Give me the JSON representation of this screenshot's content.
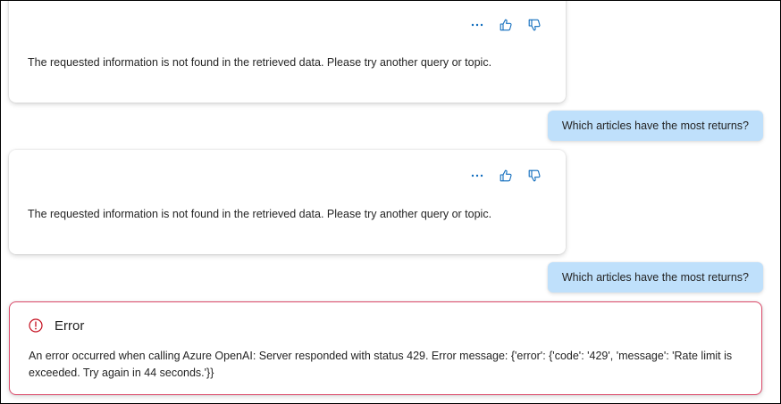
{
  "messages": [
    {
      "role": "assistant",
      "text": "The requested information is not found in the retrieved data. Please try another query or topic.",
      "actions": [
        "more-icon",
        "thumbs-up-icon",
        "thumbs-down-icon"
      ]
    },
    {
      "role": "user",
      "text": "Which articles have the most returns?"
    },
    {
      "role": "assistant",
      "text": "The requested information is not found in the retrieved data. Please try another query or topic.",
      "actions": [
        "more-icon",
        "thumbs-up-icon",
        "thumbs-down-icon"
      ]
    },
    {
      "role": "user",
      "text": "Which articles have the most returns?"
    }
  ],
  "error": {
    "title": "Error",
    "message": "An error occurred when calling Azure OpenAI: Server responded with status 429. Error message: {'error': {'code': '429', 'message': 'Rate limit is exceeded. Try again in 44 seconds.'}}",
    "icon": "error-circle-icon"
  },
  "colors": {
    "accent": "#0f6cbd",
    "user_bubble": "#bfe0fb",
    "error_border": "#dc4a6a",
    "error_icon": "#c50f1f"
  }
}
